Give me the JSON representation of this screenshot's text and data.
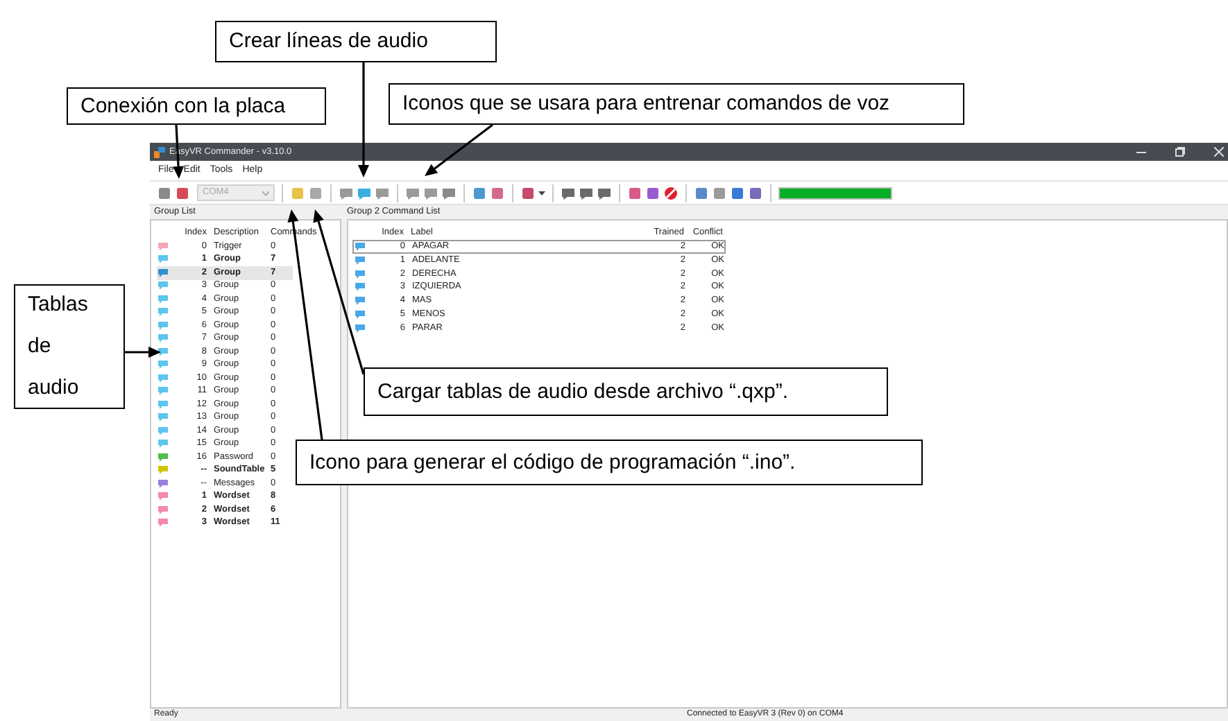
{
  "annotations": [
    {
      "text": "Crear líneas de audio"
    },
    {
      "text": "Conexión con la placa"
    },
    {
      "text": "Iconos que se usara para entrenar comandos de voz"
    },
    {
      "text": "Tablas de audio"
    },
    {
      "text": "Cargar tablas de audio desde archivo “.qxp”."
    },
    {
      "text": "Icono para generar el código de programación “.ino”."
    }
  ],
  "window": {
    "title": "EasyVR Commander - v3.10.0"
  },
  "menu": [
    "File",
    "Edit",
    "Tools",
    "Help"
  ],
  "toolbar": {
    "port": {
      "value": "COM4",
      "disabled": true
    },
    "progress": {
      "level": 1
    }
  },
  "group_list": {
    "title": "Group List",
    "columns": [
      "Index",
      "Description",
      "Commands"
    ],
    "rows": [
      {
        "index": "0",
        "description": "Trigger",
        "commands": "0",
        "bold": false,
        "selected": false,
        "color": "#f4a6b8"
      },
      {
        "index": "1",
        "description": "Group",
        "commands": "7",
        "bold": true,
        "selected": false,
        "color": "#5cc6ee"
      },
      {
        "index": "2",
        "description": "Group",
        "commands": "7",
        "bold": true,
        "selected": true,
        "color": "#2f8fd0"
      },
      {
        "index": "3",
        "description": "Group",
        "commands": "0",
        "bold": false,
        "selected": false,
        "color": "#5cc6ee"
      },
      {
        "index": "4",
        "description": "Group",
        "commands": "0",
        "bold": false,
        "selected": false,
        "color": "#5cc6ee"
      },
      {
        "index": "5",
        "description": "Group",
        "commands": "0",
        "bold": false,
        "selected": false,
        "color": "#5cc6ee"
      },
      {
        "index": "6",
        "description": "Group",
        "commands": "0",
        "bold": false,
        "selected": false,
        "color": "#5cc6ee"
      },
      {
        "index": "7",
        "description": "Group",
        "commands": "0",
        "bold": false,
        "selected": false,
        "color": "#5cc6ee"
      },
      {
        "index": "8",
        "description": "Group",
        "commands": "0",
        "bold": false,
        "selected": false,
        "color": "#5cc6ee"
      },
      {
        "index": "9",
        "description": "Group",
        "commands": "0",
        "bold": false,
        "selected": false,
        "color": "#5cc6ee"
      },
      {
        "index": "10",
        "description": "Group",
        "commands": "0",
        "bold": false,
        "selected": false,
        "color": "#5cc6ee"
      },
      {
        "index": "11",
        "description": "Group",
        "commands": "0",
        "bold": false,
        "selected": false,
        "color": "#5cc6ee"
      },
      {
        "index": "12",
        "description": "Group",
        "commands": "0",
        "bold": false,
        "selected": false,
        "color": "#5cc6ee"
      },
      {
        "index": "13",
        "description": "Group",
        "commands": "0",
        "bold": false,
        "selected": false,
        "color": "#5cc6ee"
      },
      {
        "index": "14",
        "description": "Group",
        "commands": "0",
        "bold": false,
        "selected": false,
        "color": "#5cc6ee"
      },
      {
        "index": "15",
        "description": "Group",
        "commands": "0",
        "bold": false,
        "selected": false,
        "color": "#5cc6ee"
      },
      {
        "index": "16",
        "description": "Password",
        "commands": "0",
        "bold": false,
        "selected": false,
        "color": "#4cbf4c"
      },
      {
        "index": "--",
        "description": "SoundTable",
        "commands": "5",
        "bold": true,
        "selected": false,
        "color": "#d4c400"
      },
      {
        "index": "--",
        "description": "Messages",
        "commands": "0",
        "bold": false,
        "selected": false,
        "color": "#9b7fe0"
      },
      {
        "index": "1",
        "description": "Wordset",
        "commands": "8",
        "bold": true,
        "selected": false,
        "color": "#f28aa8"
      },
      {
        "index": "2",
        "description": "Wordset",
        "commands": "6",
        "bold": true,
        "selected": false,
        "color": "#f28aa8"
      },
      {
        "index": "3",
        "description": "Wordset",
        "commands": "11",
        "bold": true,
        "selected": false,
        "color": "#f28aa8"
      }
    ]
  },
  "command_list": {
    "title": "Group 2 Command List",
    "columns": [
      "Index",
      "Label",
      "Trained",
      "Conflict"
    ],
    "rows": [
      {
        "index": "0",
        "label": "APAGAR",
        "trained": "2",
        "conflict": "OK",
        "selected": true
      },
      {
        "index": "1",
        "label": "ADELANTE",
        "trained": "2",
        "conflict": "OK",
        "selected": false
      },
      {
        "index": "2",
        "label": "DERECHA",
        "trained": "2",
        "conflict": "OK",
        "selected": false
      },
      {
        "index": "3",
        "label": "IZQUIERDA",
        "trained": "2",
        "conflict": "OK",
        "selected": false
      },
      {
        "index": "4",
        "label": "MAS",
        "trained": "2",
        "conflict": "OK",
        "selected": false
      },
      {
        "index": "5",
        "label": "MENOS",
        "trained": "2",
        "conflict": "OK",
        "selected": false
      },
      {
        "index": "6",
        "label": "PARAR",
        "trained": "2",
        "conflict": "OK",
        "selected": false
      }
    ]
  },
  "status_bar": {
    "left": "Ready",
    "right": "Connected to EasyVR 3 (Rev 0) on COM4"
  }
}
